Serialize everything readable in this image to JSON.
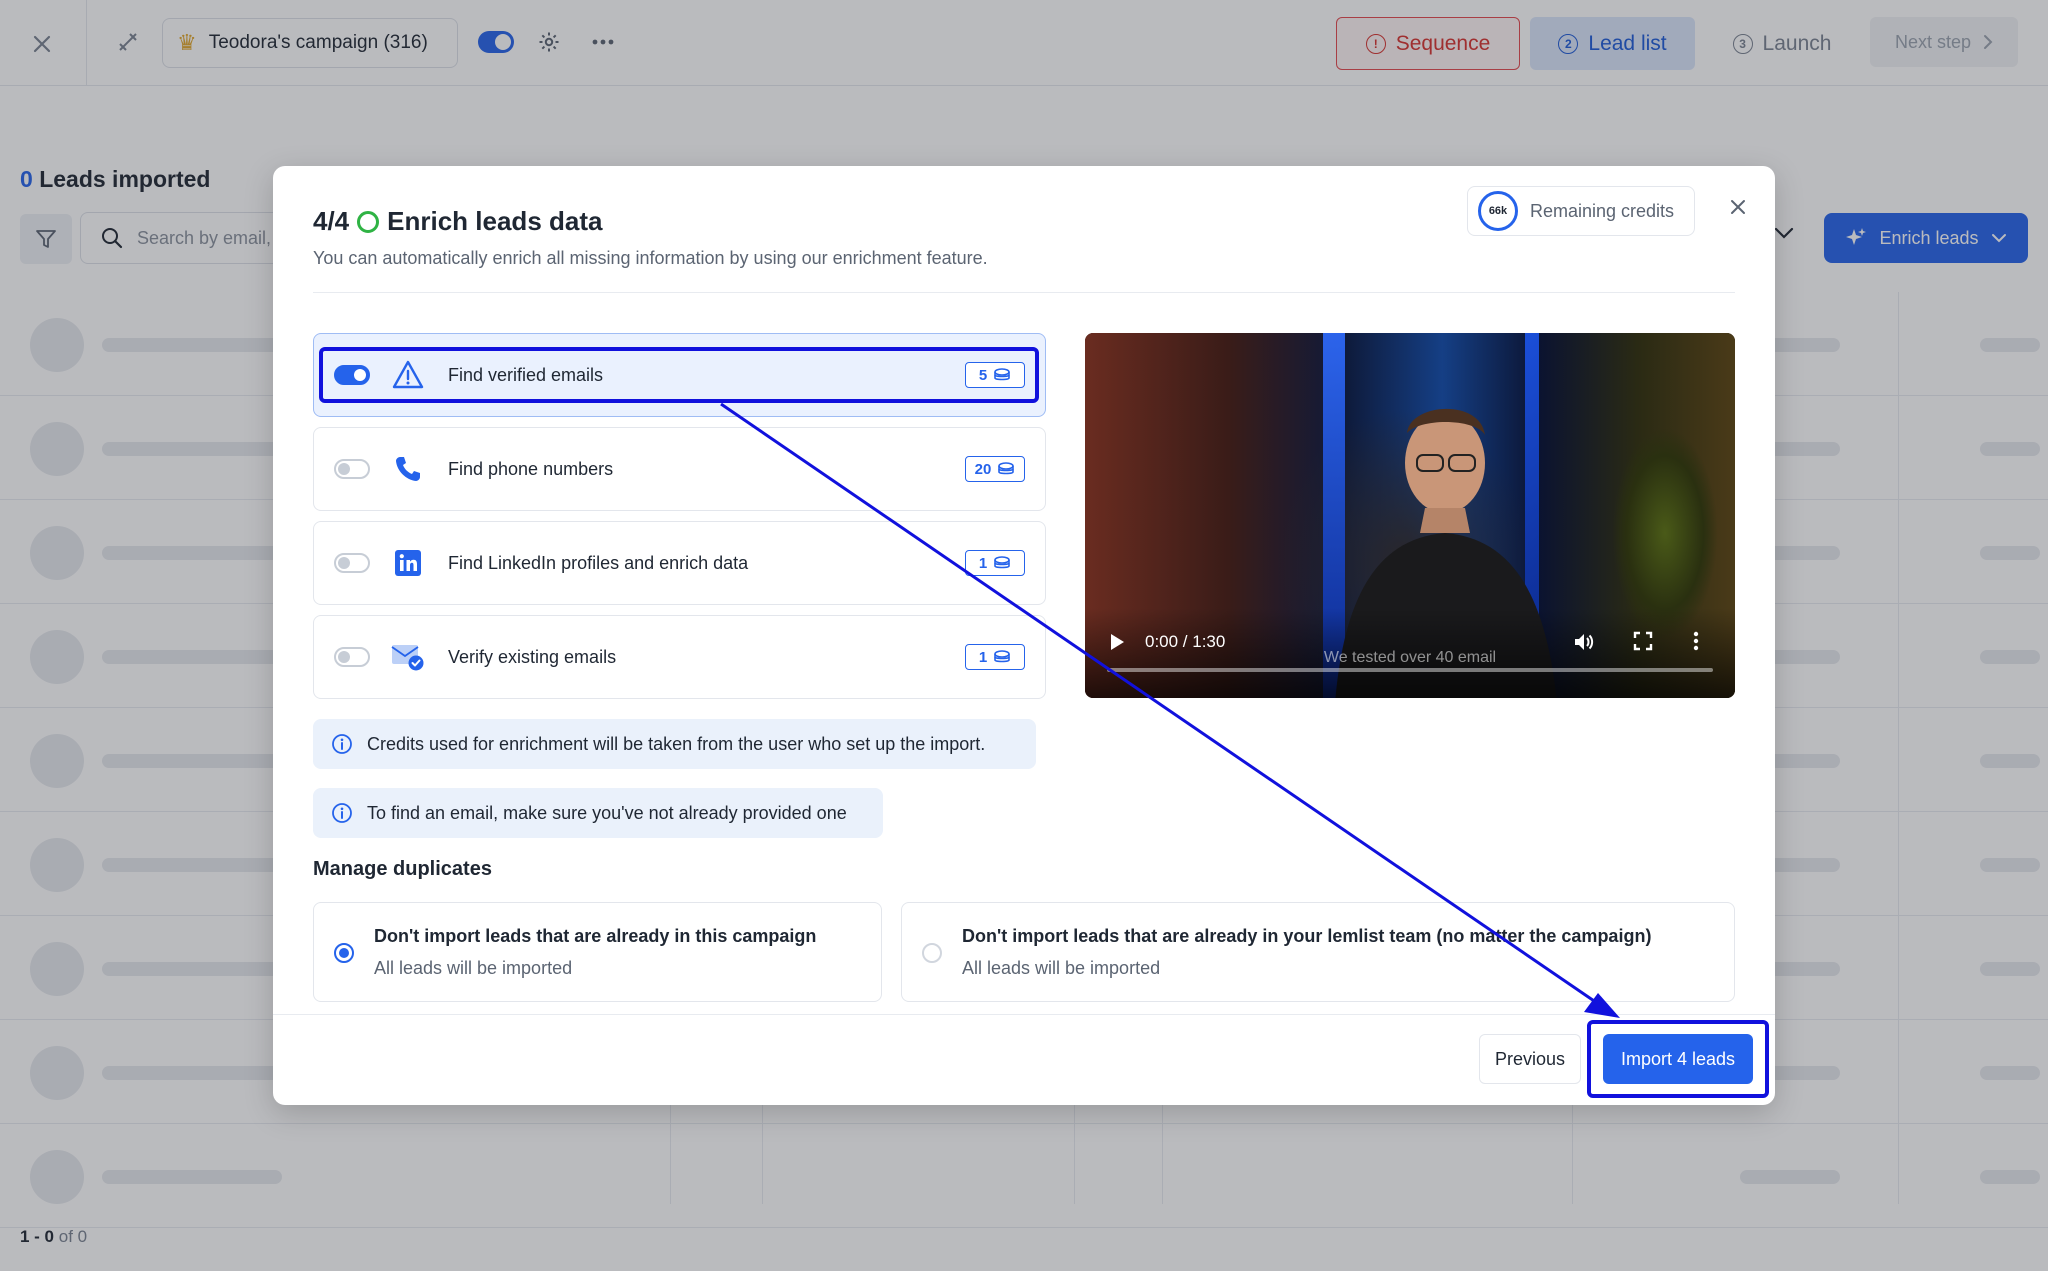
{
  "topbar": {
    "campaign_name": "Teodora's campaign (316)",
    "steps": [
      {
        "num": "!",
        "label": "Sequence",
        "state": "error"
      },
      {
        "num": "2",
        "label": "Lead list",
        "state": "active"
      },
      {
        "num": "3",
        "label": "Launch",
        "state": "inactive"
      }
    ],
    "next_step_label": "Next step"
  },
  "page": {
    "leads_count": "0",
    "leads_label": "Leads imported",
    "search_placeholder": "Search by email,",
    "enrich_button_label": "Enrich leads",
    "pager": {
      "range": "1 - 0",
      "of_label": "of 0"
    }
  },
  "modal": {
    "step": "4/4",
    "title": "Enrich leads data",
    "subtitle": "You can automatically enrich all missing information by using our enrichment feature.",
    "credits_gauge_label": "66k",
    "credits_label": "Remaining credits",
    "options": [
      {
        "label": "Find verified emails",
        "credits": "5",
        "enabled": true,
        "icon": "warning-icon"
      },
      {
        "label": "Find phone numbers",
        "credits": "20",
        "enabled": false,
        "icon": "phone-icon"
      },
      {
        "label": "Find LinkedIn profiles and enrich data",
        "credits": "1",
        "enabled": false,
        "icon": "linkedin-icon"
      },
      {
        "label": "Verify existing emails",
        "credits": "1",
        "enabled": false,
        "icon": "mail-check-icon"
      }
    ],
    "info_credits": "Credits used for enrichment will be taken from the user who set up the import.",
    "info_email": "To find an email, make sure you've not already provided one",
    "video": {
      "time": "0:00 / 1:30",
      "caption": "We tested over 40 email"
    },
    "duplicates_title": "Manage duplicates",
    "duplicates": [
      {
        "title": "Don't import leads that are already in this campaign",
        "subtitle": "All leads will be imported",
        "selected": true
      },
      {
        "title": "Don't import leads that are already in your lemlist team (no matter the campaign)",
        "subtitle": "All leads will be imported",
        "selected": false
      }
    ],
    "previous_label": "Previous",
    "import_label": "Import 4 leads"
  },
  "colors": {
    "accent": "#2563eb",
    "error": "#d8322e",
    "annotation": "#1111dd",
    "success": "#2fb344"
  }
}
